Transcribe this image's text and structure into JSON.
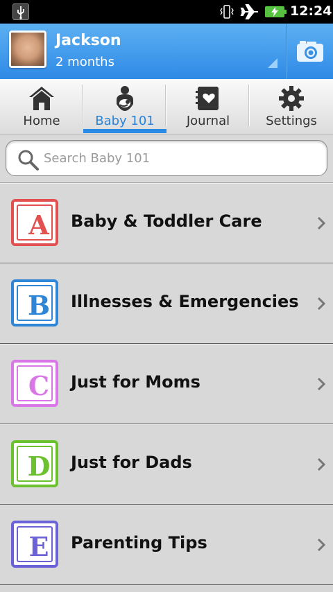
{
  "status_bar": {
    "time": "12:24",
    "icons": [
      "usb-icon",
      "vibrate-icon",
      "airplane-icon",
      "battery-charging-icon"
    ]
  },
  "header": {
    "child_name": "Jackson",
    "child_age": "2 months",
    "camera_icon": "camera-icon"
  },
  "tabs": [
    {
      "label": "Home",
      "icon": "home-icon",
      "active": false
    },
    {
      "label": "Baby 101",
      "icon": "baby-icon",
      "active": true
    },
    {
      "label": "Journal",
      "icon": "journal-icon",
      "active": false
    },
    {
      "label": "Settings",
      "icon": "gear-icon",
      "active": false
    }
  ],
  "search": {
    "placeholder": "Search Baby 101"
  },
  "categories": [
    {
      "letter": "A",
      "label": "Baby & Toddler Care",
      "color": "#e25050"
    },
    {
      "letter": "B",
      "label": "Illnesses & Emergencies",
      "color": "#2f86d6"
    },
    {
      "letter": "C",
      "label": "Just for Moms",
      "color": "#d977e6"
    },
    {
      "letter": "D",
      "label": "Just for Dads",
      "color": "#6cc12e"
    },
    {
      "letter": "E",
      "label": "Parenting Tips",
      "color": "#6b62d8"
    }
  ]
}
